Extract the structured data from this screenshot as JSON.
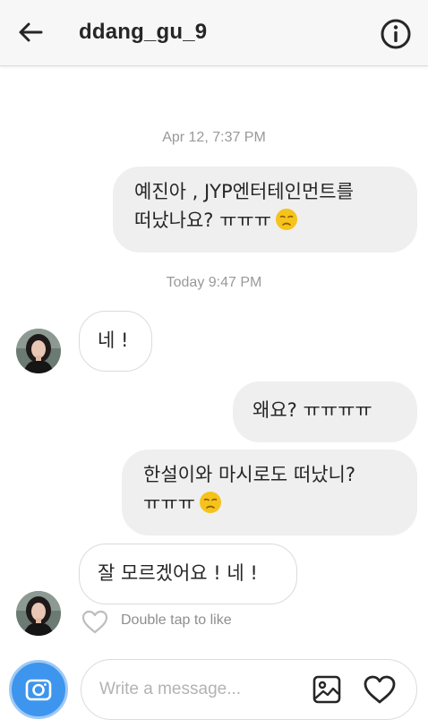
{
  "header": {
    "username": "ddang_gu_9",
    "back_icon": "arrow-left-icon",
    "info_icon": "info-circle-icon"
  },
  "timestamps": [
    "Apr 12, 7:37 PM",
    "Today 9:47 PM"
  ],
  "messages": [
    {
      "direction": "outgoing",
      "lines": [
        "예진아 , JYP엔터테인먼트를",
        "떠났나요? ㅠㅠㅠ"
      ],
      "emoji": "sad-face-emoji"
    },
    {
      "direction": "incoming",
      "text": "네 !"
    },
    {
      "direction": "outgoing",
      "text": "왜요? ㅠㅠㅠㅠ"
    },
    {
      "direction": "outgoing",
      "lines": [
        "한설이와 마시로도 떠났니?",
        "ㅠㅠㅠ"
      ],
      "emoji": "sad-face-emoji"
    },
    {
      "direction": "incoming",
      "text": "잘 모르겠어요 ! 네 !"
    }
  ],
  "like_hint": "Double tap to like",
  "composer": {
    "placeholder": "Write a message...",
    "camera_icon": "camera-icon",
    "gallery_icon": "image-gallery-icon",
    "like_icon": "heart-icon"
  },
  "colors": {
    "header_bg": "#f7f7f7",
    "outgoing_bubble": "#efefef",
    "incoming_border": "#dbdbdb",
    "camera_button": "#3d95ee",
    "emoji": "#f5c31b"
  }
}
